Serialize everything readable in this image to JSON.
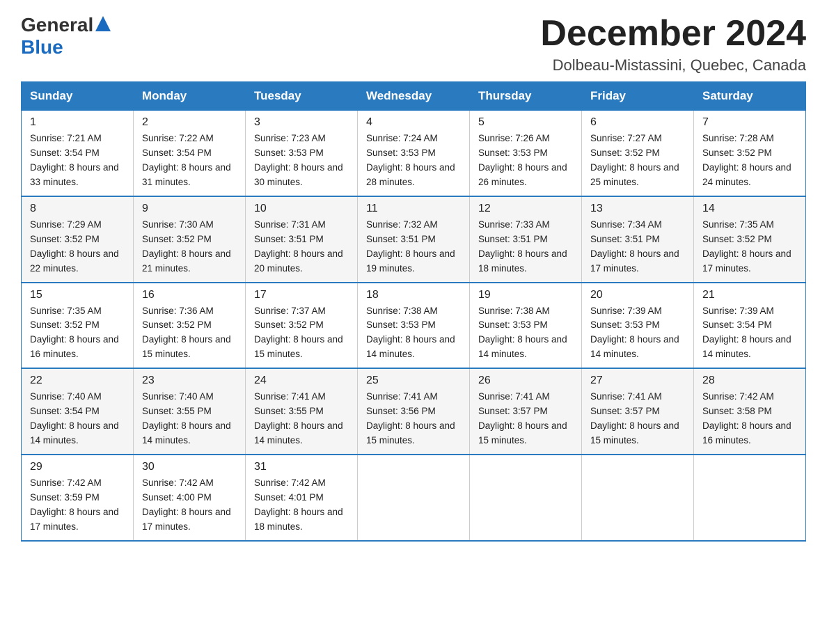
{
  "header": {
    "logo": {
      "text1": "General",
      "arrow": "▲",
      "text2": "Blue"
    },
    "title": "December 2024",
    "location": "Dolbeau-Mistassini, Quebec, Canada"
  },
  "calendar": {
    "days_of_week": [
      "Sunday",
      "Monday",
      "Tuesday",
      "Wednesday",
      "Thursday",
      "Friday",
      "Saturday"
    ],
    "weeks": [
      [
        {
          "day": "1",
          "sunrise": "7:21 AM",
          "sunset": "3:54 PM",
          "daylight": "8 hours and 33 minutes."
        },
        {
          "day": "2",
          "sunrise": "7:22 AM",
          "sunset": "3:54 PM",
          "daylight": "8 hours and 31 minutes."
        },
        {
          "day": "3",
          "sunrise": "7:23 AM",
          "sunset": "3:53 PM",
          "daylight": "8 hours and 30 minutes."
        },
        {
          "day": "4",
          "sunrise": "7:24 AM",
          "sunset": "3:53 PM",
          "daylight": "8 hours and 28 minutes."
        },
        {
          "day": "5",
          "sunrise": "7:26 AM",
          "sunset": "3:53 PM",
          "daylight": "8 hours and 26 minutes."
        },
        {
          "day": "6",
          "sunrise": "7:27 AM",
          "sunset": "3:52 PM",
          "daylight": "8 hours and 25 minutes."
        },
        {
          "day": "7",
          "sunrise": "7:28 AM",
          "sunset": "3:52 PM",
          "daylight": "8 hours and 24 minutes."
        }
      ],
      [
        {
          "day": "8",
          "sunrise": "7:29 AM",
          "sunset": "3:52 PM",
          "daylight": "8 hours and 22 minutes."
        },
        {
          "day": "9",
          "sunrise": "7:30 AM",
          "sunset": "3:52 PM",
          "daylight": "8 hours and 21 minutes."
        },
        {
          "day": "10",
          "sunrise": "7:31 AM",
          "sunset": "3:51 PM",
          "daylight": "8 hours and 20 minutes."
        },
        {
          "day": "11",
          "sunrise": "7:32 AM",
          "sunset": "3:51 PM",
          "daylight": "8 hours and 19 minutes."
        },
        {
          "day": "12",
          "sunrise": "7:33 AM",
          "sunset": "3:51 PM",
          "daylight": "8 hours and 18 minutes."
        },
        {
          "day": "13",
          "sunrise": "7:34 AM",
          "sunset": "3:51 PM",
          "daylight": "8 hours and 17 minutes."
        },
        {
          "day": "14",
          "sunrise": "7:35 AM",
          "sunset": "3:52 PM",
          "daylight": "8 hours and 17 minutes."
        }
      ],
      [
        {
          "day": "15",
          "sunrise": "7:35 AM",
          "sunset": "3:52 PM",
          "daylight": "8 hours and 16 minutes."
        },
        {
          "day": "16",
          "sunrise": "7:36 AM",
          "sunset": "3:52 PM",
          "daylight": "8 hours and 15 minutes."
        },
        {
          "day": "17",
          "sunrise": "7:37 AM",
          "sunset": "3:52 PM",
          "daylight": "8 hours and 15 minutes."
        },
        {
          "day": "18",
          "sunrise": "7:38 AM",
          "sunset": "3:53 PM",
          "daylight": "8 hours and 14 minutes."
        },
        {
          "day": "19",
          "sunrise": "7:38 AM",
          "sunset": "3:53 PM",
          "daylight": "8 hours and 14 minutes."
        },
        {
          "day": "20",
          "sunrise": "7:39 AM",
          "sunset": "3:53 PM",
          "daylight": "8 hours and 14 minutes."
        },
        {
          "day": "21",
          "sunrise": "7:39 AM",
          "sunset": "3:54 PM",
          "daylight": "8 hours and 14 minutes."
        }
      ],
      [
        {
          "day": "22",
          "sunrise": "7:40 AM",
          "sunset": "3:54 PM",
          "daylight": "8 hours and 14 minutes."
        },
        {
          "day": "23",
          "sunrise": "7:40 AM",
          "sunset": "3:55 PM",
          "daylight": "8 hours and 14 minutes."
        },
        {
          "day": "24",
          "sunrise": "7:41 AM",
          "sunset": "3:55 PM",
          "daylight": "8 hours and 14 minutes."
        },
        {
          "day": "25",
          "sunrise": "7:41 AM",
          "sunset": "3:56 PM",
          "daylight": "8 hours and 15 minutes."
        },
        {
          "day": "26",
          "sunrise": "7:41 AM",
          "sunset": "3:57 PM",
          "daylight": "8 hours and 15 minutes."
        },
        {
          "day": "27",
          "sunrise": "7:41 AM",
          "sunset": "3:57 PM",
          "daylight": "8 hours and 15 minutes."
        },
        {
          "day": "28",
          "sunrise": "7:42 AM",
          "sunset": "3:58 PM",
          "daylight": "8 hours and 16 minutes."
        }
      ],
      [
        {
          "day": "29",
          "sunrise": "7:42 AM",
          "sunset": "3:59 PM",
          "daylight": "8 hours and 17 minutes."
        },
        {
          "day": "30",
          "sunrise": "7:42 AM",
          "sunset": "4:00 PM",
          "daylight": "8 hours and 17 minutes."
        },
        {
          "day": "31",
          "sunrise": "7:42 AM",
          "sunset": "4:01 PM",
          "daylight": "8 hours and 18 minutes."
        },
        null,
        null,
        null,
        null
      ]
    ]
  }
}
